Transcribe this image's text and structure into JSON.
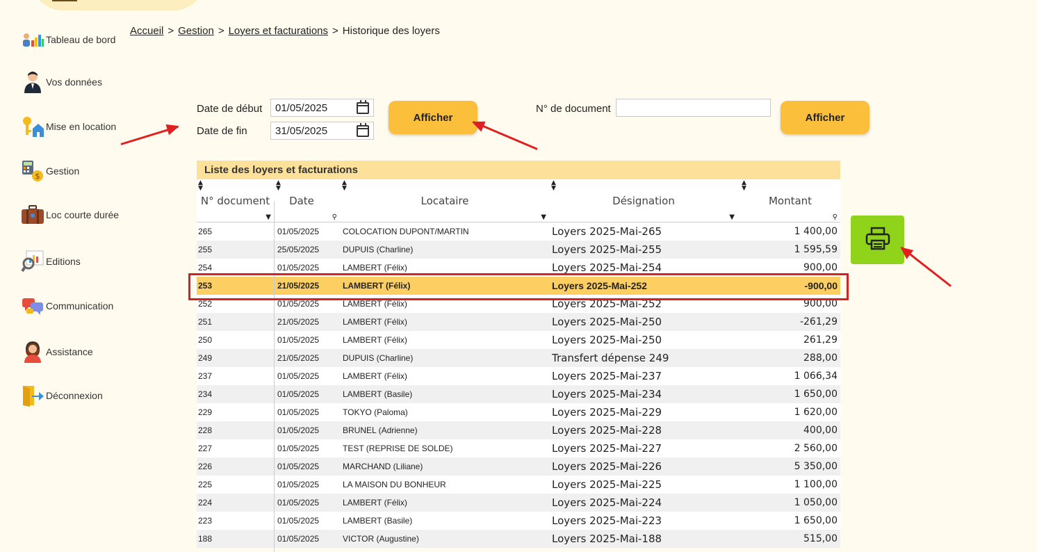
{
  "sidebar": {
    "items": [
      {
        "label": "Tableau de bord",
        "icon": "dashboard-chart-icon"
      },
      {
        "label": "Vos données",
        "icon": "user-person-icon"
      },
      {
        "label": "Mise en location",
        "icon": "keys-house-icon"
      },
      {
        "label": "Gestion",
        "icon": "calculator-money-icon"
      },
      {
        "label": "Loc courte durée",
        "icon": "suitcase-icon"
      },
      {
        "label": "Editions",
        "icon": "magnifier-chart-icon"
      },
      {
        "label": "Communication",
        "icon": "chat-bubbles-icon"
      },
      {
        "label": "Assistance",
        "icon": "support-agent-icon"
      },
      {
        "label": "Déconnexion",
        "icon": "logout-door-icon"
      }
    ]
  },
  "breadcrumb": {
    "home": "Accueil",
    "gestion": "Gestion",
    "loyers": "Loyers et facturations",
    "current": "Historique des loyers",
    "separator": ">"
  },
  "filters": {
    "start_label": "Date de début",
    "start_value": "01/05/2025",
    "end_label": "Date de fin",
    "end_value": "31/05/2025",
    "show_label": "Afficher",
    "doc_label": "N° de document",
    "doc_value": "",
    "show_doc_label": "Afficher"
  },
  "print": {
    "icon": "printer-icon",
    "color": "#8fd41a"
  },
  "table": {
    "caption": "Liste des loyers et facturations",
    "headers": {
      "doc": "N° document",
      "date": "Date",
      "locataire": "Locataire",
      "designation": "Désignation",
      "montant": "Montant"
    },
    "rows": [
      {
        "doc": "265",
        "date": "01/05/2025",
        "locataire": "COLOCATION DUPONT/MARTIN",
        "designation": "Loyers 2025-Mai-265",
        "montant": "1 400,00"
      },
      {
        "doc": "255",
        "date": "25/05/2025",
        "locataire": "DUPUIS (Charline)",
        "designation": "Loyers 2025-Mai-255",
        "montant": "1 595,59"
      },
      {
        "doc": "254",
        "date": "01/05/2025",
        "locataire": "LAMBERT (Félix)",
        "designation": "Loyers 2025-Mai-254",
        "montant": "900,00"
      },
      {
        "doc": "253",
        "date": "21/05/2025",
        "locataire": "LAMBERT (Félix)",
        "designation": "Loyers 2025-Mai-252",
        "montant": "-900,00",
        "highlight": true
      },
      {
        "doc": "252",
        "date": "01/05/2025",
        "locataire": "LAMBERT (Félix)",
        "designation": "Loyers 2025-Mai-252",
        "montant": "900,00"
      },
      {
        "doc": "251",
        "date": "21/05/2025",
        "locataire": "LAMBERT (Félix)",
        "designation": "Loyers 2025-Mai-250",
        "montant": "-261,29"
      },
      {
        "doc": "250",
        "date": "01/05/2025",
        "locataire": "LAMBERT (Félix)",
        "designation": "Loyers 2025-Mai-250",
        "montant": "261,29"
      },
      {
        "doc": "249",
        "date": "21/05/2025",
        "locataire": "DUPUIS (Charline)",
        "designation": "Transfert dépense 249",
        "montant": "288,00"
      },
      {
        "doc": "237",
        "date": "01/05/2025",
        "locataire": "LAMBERT (Félix)",
        "designation": "Loyers 2025-Mai-237",
        "montant": "1 066,34"
      },
      {
        "doc": "234",
        "date": "01/05/2025",
        "locataire": "LAMBERT (Basile)",
        "designation": "Loyers 2025-Mai-234",
        "montant": "1 650,00"
      },
      {
        "doc": "229",
        "date": "01/05/2025",
        "locataire": "TOKYO (Paloma)",
        "designation": "Loyers 2025-Mai-229",
        "montant": "1 620,00"
      },
      {
        "doc": "228",
        "date": "01/05/2025",
        "locataire": "BRUNEL (Adrienne)",
        "designation": "Loyers 2025-Mai-228",
        "montant": "400,00"
      },
      {
        "doc": "227",
        "date": "01/05/2025",
        "locataire": "TEST (REPRISE DE SOLDE)",
        "designation": "Loyers 2025-Mai-227",
        "montant": "2 560,00"
      },
      {
        "doc": "226",
        "date": "01/05/2025",
        "locataire": "MARCHAND (Liliane)",
        "designation": "Loyers 2025-Mai-226",
        "montant": "5 350,00"
      },
      {
        "doc": "225",
        "date": "01/05/2025",
        "locataire": "LA MAISON DU BONHEUR",
        "designation": "Loyers 2025-Mai-225",
        "montant": "1 100,00"
      },
      {
        "doc": "224",
        "date": "01/05/2025",
        "locataire": "LAMBERT (Félix)",
        "designation": "Loyers 2025-Mai-224",
        "montant": "1 050,00"
      },
      {
        "doc": "223",
        "date": "01/05/2025",
        "locataire": "LAMBERT (Basile)",
        "designation": "Loyers 2025-Mai-223",
        "montant": "1 650,00"
      },
      {
        "doc": "188",
        "date": "01/05/2025",
        "locataire": "VICTOR (Augustine)",
        "designation": "Loyers 2025-Mai-188",
        "montant": "515,00"
      }
    ]
  },
  "colors": {
    "background": "#fffbef",
    "button": "#fcbf3c",
    "caption": "#fde19a",
    "highlight_row": "#fdcf62",
    "annotation": "#e02020"
  }
}
